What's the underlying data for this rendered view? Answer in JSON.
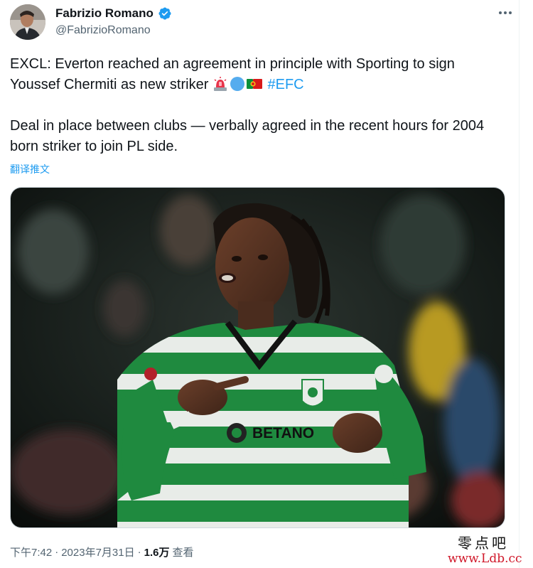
{
  "author": {
    "display_name": "Fabrizio Romano",
    "handle": "@FabrizioRomano",
    "avatar_icon": "profile-photo",
    "verified_icon": "verified-badge-icon",
    "verified_color": "#1d9bf0"
  },
  "menu": {
    "more_icon": "more-horizontal-icon"
  },
  "tweet": {
    "para1_text": "EXCL: Everton reached an agreement in principle with Sporting to sign Youssef Chermiti as new striker ",
    "emojis": [
      "police-light-emoji",
      "blue-circle-emoji",
      "portugal-flag-emoji"
    ],
    "hashtag": "#EFC",
    "para2_text": "Deal in place between clubs — verbally agreed in the recent hours for 2004 born striker to join PL side.",
    "translate_label": "翻译推文"
  },
  "media": {
    "description_icon": "football-player-photo",
    "jersey_sponsor": "BETANO",
    "jersey_crest": "SCP"
  },
  "meta": {
    "time": "下午7:42",
    "separator": "·",
    "date": "2023年7月31日",
    "separator2": "·",
    "views_count": "1.6万",
    "views_label": "查看"
  },
  "watermark": {
    "top": "零点吧",
    "bottom": "www.Ldb.cc"
  },
  "colors": {
    "link": "#1d9bf0",
    "secondary_text": "#536471",
    "primary_text": "#0f1419",
    "jersey_green": "#1f8a3f"
  }
}
